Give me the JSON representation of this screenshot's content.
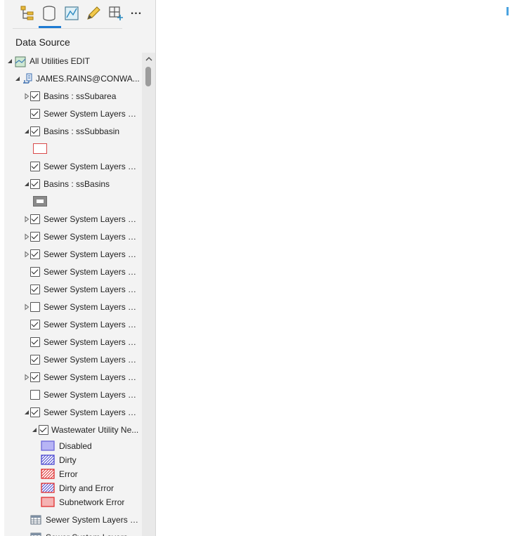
{
  "panel": {
    "heading": "Data Source",
    "toolbar": [
      {
        "icon": "list-by-drawing-order-icon"
      },
      {
        "icon": "list-by-data-source-icon",
        "selected": true
      },
      {
        "icon": "list-by-selection-icon"
      },
      {
        "icon": "list-by-editing-icon"
      },
      {
        "icon": "list-by-snapping-icon"
      },
      {
        "icon": "more-options-icon",
        "label": "..."
      }
    ]
  },
  "tree": {
    "root_label": "All Utilities EDIT",
    "connection_label": "JAMES.RAINS@CONWA...",
    "items": [
      {
        "label": "Basins : ssSubarea",
        "checked": true,
        "expander": "collapsed"
      },
      {
        "label": "Sewer System Layers ED...",
        "checked": true,
        "expander": "none"
      },
      {
        "label": "Basins : ssSubbasin",
        "checked": true,
        "expander": "expanded"
      },
      {
        "label": "Sewer System Layers ED...",
        "checked": true,
        "expander": "none"
      },
      {
        "label": "Basins : ssBasins",
        "checked": true,
        "expander": "expanded"
      },
      {
        "label": "Sewer System Layers ED...",
        "checked": true,
        "expander": "collapsed"
      },
      {
        "label": "Sewer System Layers ED...",
        "checked": true,
        "expander": "collapsed"
      },
      {
        "label": "Sewer System Layers ED...",
        "checked": true,
        "expander": "collapsed"
      },
      {
        "label": "Sewer System Layers ED...",
        "checked": true,
        "expander": "none"
      },
      {
        "label": "Sewer System Layers ED...",
        "checked": true,
        "expander": "none"
      },
      {
        "label": "Sewer System Layers ED...",
        "checked": false,
        "expander": "collapsed"
      },
      {
        "label": "Sewer System Layers ED...",
        "checked": true,
        "expander": "none"
      },
      {
        "label": "Sewer System Layers ED...",
        "checked": true,
        "expander": "none"
      },
      {
        "label": "Sewer System Layers ED...",
        "checked": true,
        "expander": "none"
      },
      {
        "label": "Sewer System Layers ED...",
        "checked": true,
        "expander": "collapsed"
      },
      {
        "label": "Sewer System Layers ED...",
        "checked": false,
        "expander": "none"
      },
      {
        "label": "Sewer System Layers ED...",
        "checked": true,
        "expander": "expanded"
      },
      {
        "label": "Wastewater Utility Ne...",
        "checked": true,
        "expander": "expanded"
      }
    ],
    "legend": [
      {
        "label": "Disabled",
        "style": "solid",
        "fill": "#b7b4f5",
        "stroke": "#6a64d8"
      },
      {
        "label": "Dirty",
        "style": "hatch",
        "fill": "#4b49d1",
        "stroke": "#4b49d1"
      },
      {
        "label": "Error",
        "style": "hatch",
        "fill": "#e03131",
        "stroke": "#e03131"
      },
      {
        "label": "Dirty and Error",
        "style": "cross",
        "fill": "#4b49d1",
        "stroke": "#e03131"
      },
      {
        "label": "Subnetwork Error",
        "style": "solid",
        "fill": "#f5b3b3",
        "stroke": "#e03131"
      }
    ],
    "tables": [
      {
        "label": "Sewer System Layers E..."
      },
      {
        "label": "Sewer System Layers E..."
      }
    ]
  },
  "colors": {
    "accent": "#1e7bd3",
    "subbasin_symbol": "#d94a4a",
    "basins_symbol": "#8a8a8a"
  }
}
